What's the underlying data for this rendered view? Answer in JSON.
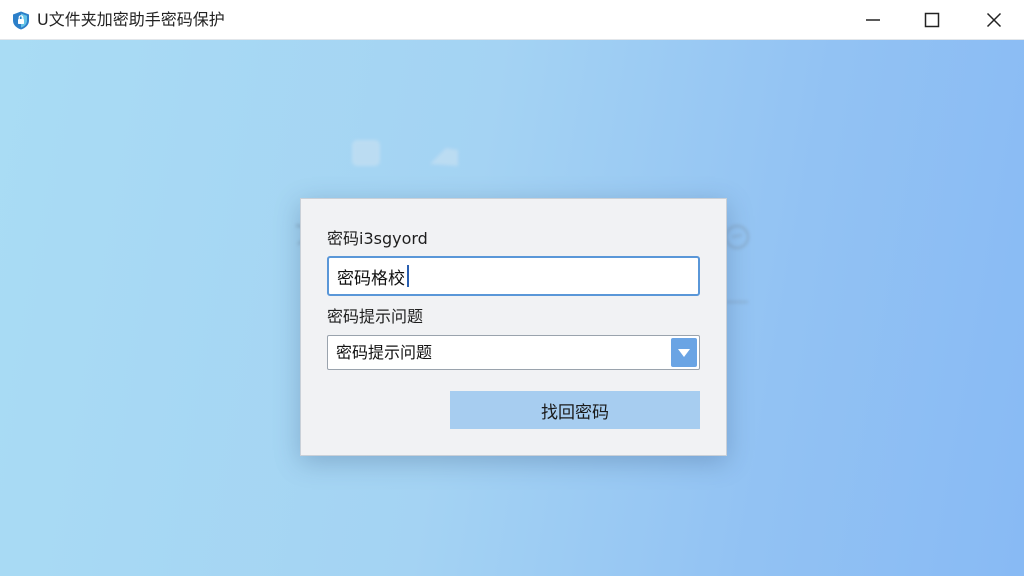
{
  "window": {
    "title": "U文件夹加密助手密码保护",
    "app_icon": "shield-lock-icon",
    "controls": [
      "minimize-icon",
      "maximize-icon",
      "close-icon"
    ]
  },
  "dialog": {
    "password_label": "密码i3sgyord",
    "password_value": "密码格校",
    "question_label": "密码提示问题",
    "question_selected": "密码提示问题",
    "recover_button": "找回密码"
  },
  "colors": {
    "background_start": "#a9dcf4",
    "background_end": "#88baf4",
    "input_focus_border": "#5a97d8",
    "dropdown_button": "#6aa4e4",
    "primary_button": "#a7cdf0"
  }
}
